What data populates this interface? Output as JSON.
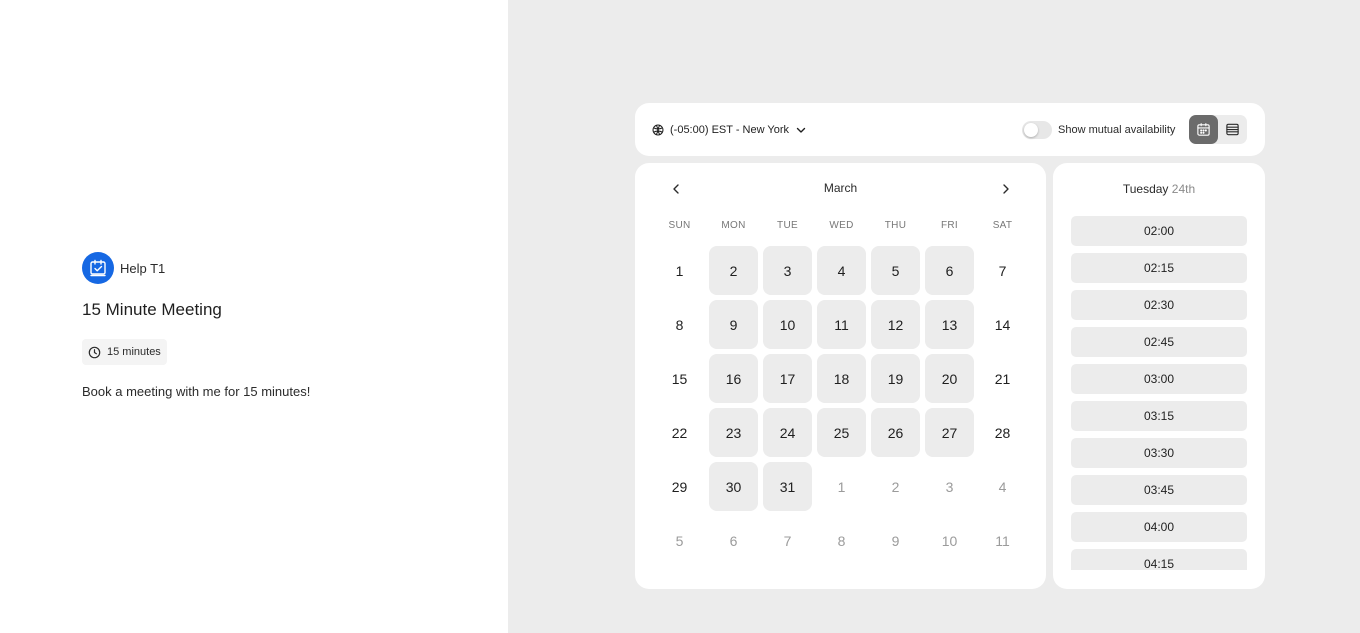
{
  "profile": {
    "host_name": "Help T1",
    "event_title": "15 Minute Meeting",
    "duration": "15 minutes",
    "description": "Book a meeting with me for 15 minutes!"
  },
  "toolbar": {
    "timezone": "(-05:00) EST - New York",
    "mutual_label": "Show mutual availability",
    "mutual_enabled": false,
    "active_view": "calendar"
  },
  "calendar": {
    "month": "March",
    "weekdays": [
      "SUN",
      "MON",
      "TUE",
      "WED",
      "THU",
      "FRI",
      "SAT"
    ],
    "weeks": [
      [
        {
          "d": "1",
          "s": "n"
        },
        {
          "d": "2",
          "s": "a"
        },
        {
          "d": "3",
          "s": "a"
        },
        {
          "d": "4",
          "s": "a"
        },
        {
          "d": "5",
          "s": "a"
        },
        {
          "d": "6",
          "s": "a"
        },
        {
          "d": "7",
          "s": "n"
        }
      ],
      [
        {
          "d": "8",
          "s": "n"
        },
        {
          "d": "9",
          "s": "a"
        },
        {
          "d": "10",
          "s": "a"
        },
        {
          "d": "11",
          "s": "a"
        },
        {
          "d": "12",
          "s": "a"
        },
        {
          "d": "13",
          "s": "a"
        },
        {
          "d": "14",
          "s": "n"
        }
      ],
      [
        {
          "d": "15",
          "s": "n"
        },
        {
          "d": "16",
          "s": "a"
        },
        {
          "d": "17",
          "s": "a"
        },
        {
          "d": "18",
          "s": "a"
        },
        {
          "d": "19",
          "s": "a"
        },
        {
          "d": "20",
          "s": "a"
        },
        {
          "d": "21",
          "s": "n"
        }
      ],
      [
        {
          "d": "22",
          "s": "n"
        },
        {
          "d": "23",
          "s": "a"
        },
        {
          "d": "24",
          "s": "a"
        },
        {
          "d": "25",
          "s": "a"
        },
        {
          "d": "26",
          "s": "a"
        },
        {
          "d": "27",
          "s": "a"
        },
        {
          "d": "28",
          "s": "n"
        }
      ],
      [
        {
          "d": "29",
          "s": "n"
        },
        {
          "d": "30",
          "s": "a"
        },
        {
          "d": "31",
          "s": "a"
        },
        {
          "d": "1",
          "s": "m"
        },
        {
          "d": "2",
          "s": "m"
        },
        {
          "d": "3",
          "s": "m"
        },
        {
          "d": "4",
          "s": "m"
        }
      ],
      [
        {
          "d": "5",
          "s": "m"
        },
        {
          "d": "6",
          "s": "m"
        },
        {
          "d": "7",
          "s": "m"
        },
        {
          "d": "8",
          "s": "m"
        },
        {
          "d": "9",
          "s": "m"
        },
        {
          "d": "10",
          "s": "m"
        },
        {
          "d": "11",
          "s": "m"
        }
      ]
    ]
  },
  "slots": {
    "weekday": "Tuesday",
    "date": "24th",
    "times": [
      "02:00",
      "02:15",
      "02:30",
      "02:45",
      "03:00",
      "03:15",
      "03:30",
      "03:45",
      "04:00",
      "04:15"
    ]
  },
  "colors": {
    "brand": "#1668e3",
    "available_day": "#ececec",
    "panel_bg": "#ececec"
  }
}
